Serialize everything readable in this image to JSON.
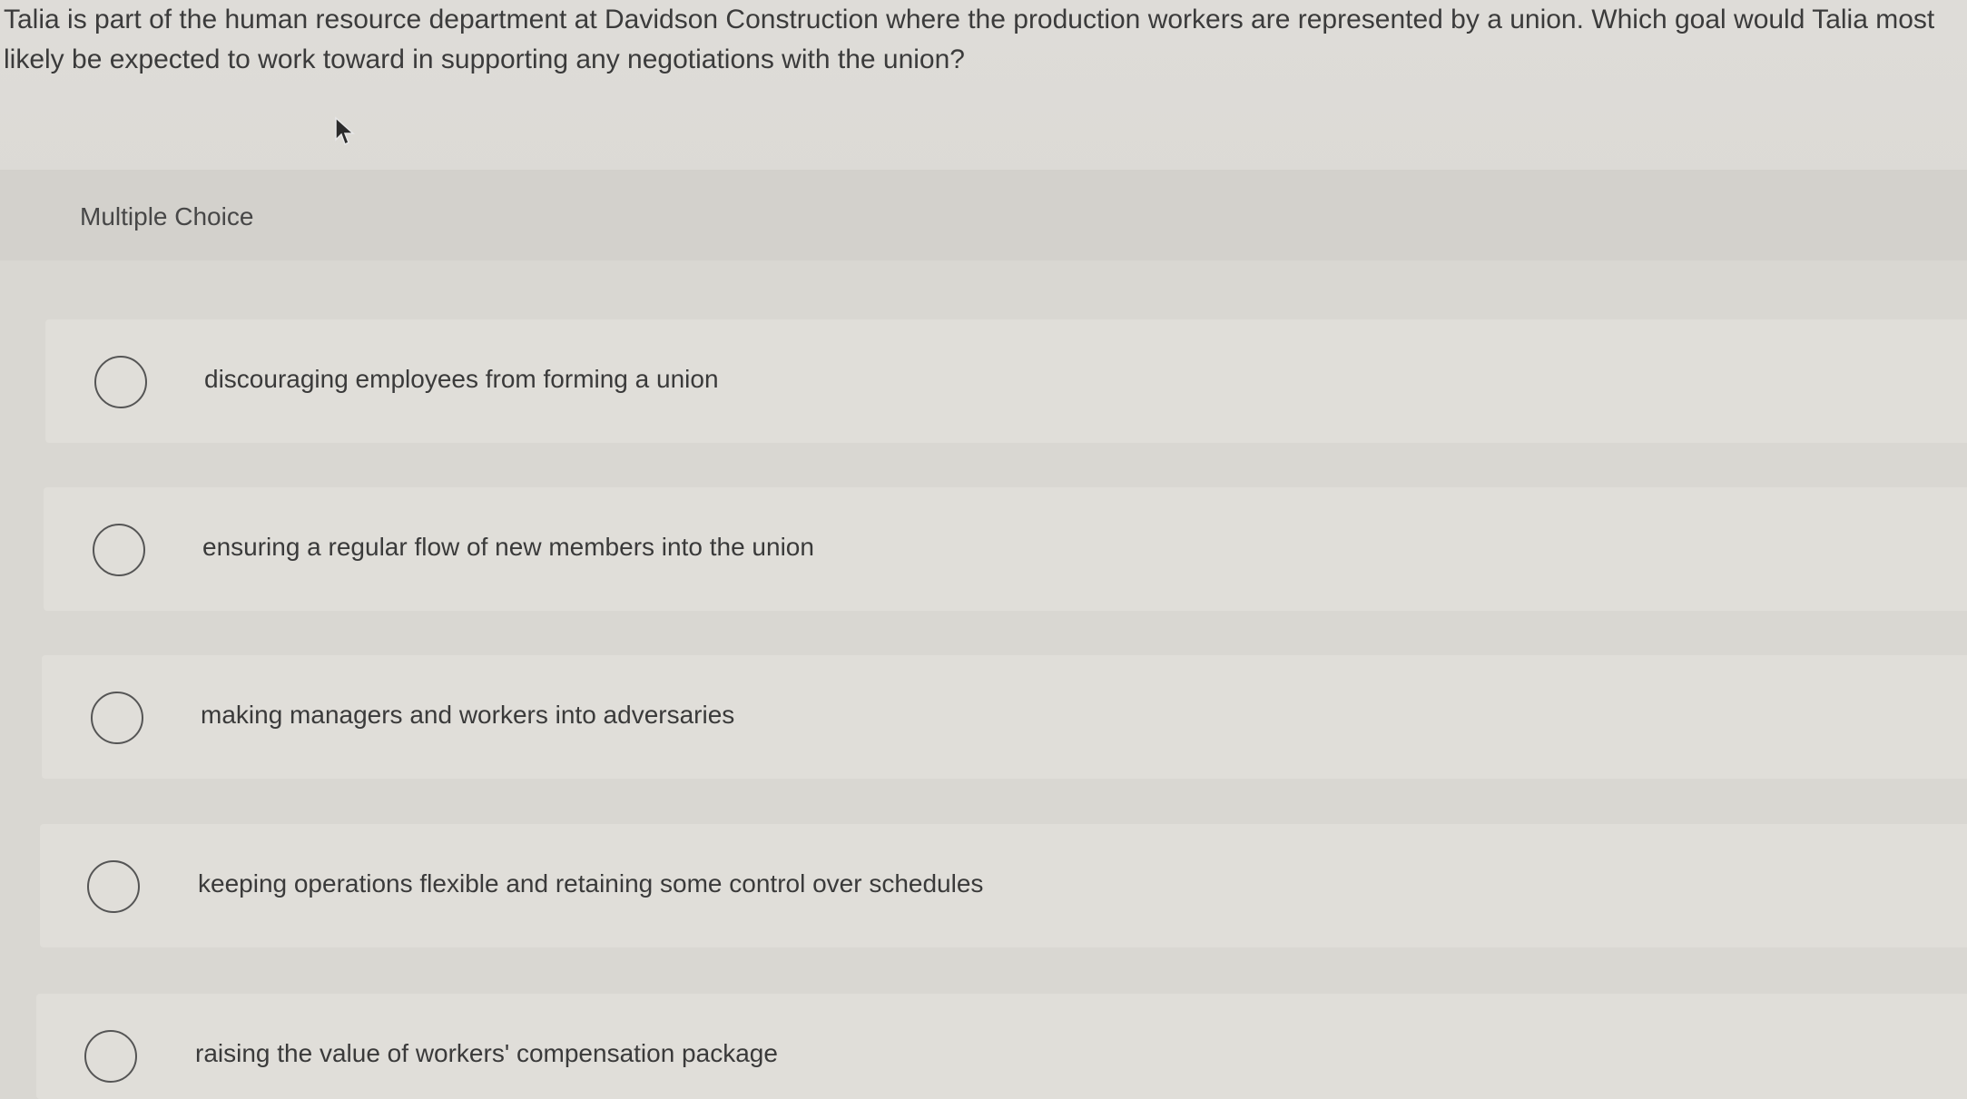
{
  "question": {
    "text": "Talia is part of the human resource department at Davidson Construction where the production workers are represented by a union. Which goal would Talia most likely be expected to work toward in supporting any negotiations with the union?"
  },
  "section": {
    "label": "Multiple Choice"
  },
  "options": [
    {
      "text": "discouraging employees from forming a union"
    },
    {
      "text": "ensuring a regular flow of new members into the union"
    },
    {
      "text": "making managers and workers into adversaries"
    },
    {
      "text": "keeping operations flexible and retaining some control over schedules"
    },
    {
      "text": "raising the value of workers' compensation package"
    }
  ]
}
